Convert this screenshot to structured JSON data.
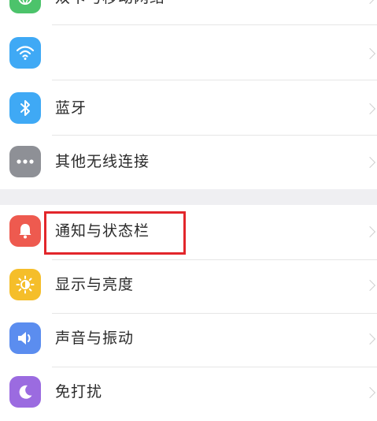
{
  "settings": {
    "group1": [
      {
        "id": "mobile-network",
        "label": "双卡与移动网络",
        "icon": "mobile-network-icon",
        "color": "#4cc36b"
      },
      {
        "id": "wlan",
        "label": "",
        "icon": "wifi-icon",
        "color": "#3fa9f5"
      },
      {
        "id": "bluetooth",
        "label": "蓝牙",
        "icon": "bluetooth-icon",
        "color": "#3fa9f5"
      },
      {
        "id": "other-wireless",
        "label": "其他无线连接",
        "icon": "more-dots-icon",
        "color": "#8e9096"
      }
    ],
    "group2": [
      {
        "id": "notification-status-bar",
        "label": "通知与状态栏",
        "icon": "notification-bell-icon",
        "color": "#ee5a4f"
      },
      {
        "id": "display-brightness",
        "label": "显示与亮度",
        "icon": "brightness-sun-icon",
        "color": "#f5be2a"
      },
      {
        "id": "sound-vibration",
        "label": "声音与振动",
        "icon": "speaker-icon",
        "color": "#5b8def"
      },
      {
        "id": "do-not-disturb",
        "label": "免打扰",
        "icon": "moon-icon",
        "color": "#9b6be0"
      }
    ]
  },
  "highlight_color": "#e2262b"
}
